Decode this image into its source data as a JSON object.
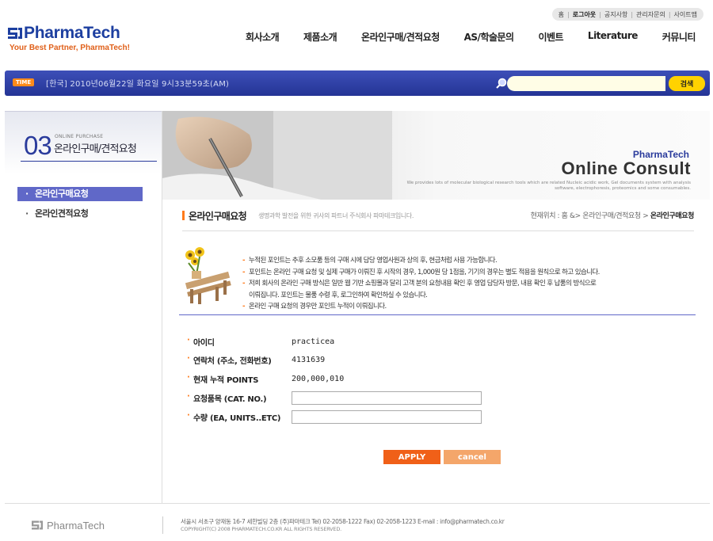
{
  "util_nav": [
    "홈",
    "로그아웃",
    "공지사항",
    "관리자문의",
    "사이트맵"
  ],
  "logo": {
    "name": "PharmaTech",
    "tagline": "Your Best Partner, PharmaTech!"
  },
  "gnb": [
    "회사소개",
    "제품소개",
    "온라인구매/견적요청",
    "AS/학술문의",
    "이벤트",
    "Literature",
    "커뮤니티"
  ],
  "timebar": {
    "badge": "TIME",
    "clock": "[한국]  2010년06월22일 화요일   9시33분59초(AM)",
    "search_button": "검색",
    "search_value": ""
  },
  "section": {
    "number": "03",
    "en": "ONLINE PURCHASE",
    "title": "온라인구매/견적요청",
    "submenu": [
      "온라인구매요청",
      "온라인견적요청"
    ]
  },
  "banner": {
    "brand": "PharmaTech",
    "title": "Online Consult",
    "desc": "We provides lots of molecular biological research tools which are related Nucleic acidic work, Gel documents system with analysis software, electrophoresis, proteomics and some consumables."
  },
  "page": {
    "title": "온라인구매요청",
    "subtitle": "생명과학 발전을 위한 귀사의 파트너 주식회사 파마테크입니다.",
    "crumb_prefix": "현재위치 : 홈 &> 온라인구매/견적요청 > ",
    "crumb_current": "온라인구매요청"
  },
  "notice": [
    "누적된 포인트는 추후 소모품 등의 구매 시에 담당 영업사원과 상의 후, 현금처럼 사용 가능합니다.",
    "포인트는 온라인 구매 요청 및 실제 구매가 이뤄진 후 시작의 경우, 1,000원 당 1점을,  기기의 경우는 별도 적용을 원칙으로 하고 있습니다.",
    "저희 회사의 온라인 구매 방식은 일반 웹 기반 쇼핑몰과 달리 고객 분의 요청내용 확인 후 영업 담당자 방문, 내용 확인 후 납품의 방식으로",
    "이뤄집니다. 포인트는 물품 수령 후, 로그인하여 확인하실 수 있습니다.",
    "온라인 구매 요청의 경우만 포인트 누적이 이뤄집니다."
  ],
  "form": {
    "id_label": "아이디",
    "id_value": "practicea",
    "contact_label": "연락처 (주소, 전화번호)",
    "contact_value": "4131639",
    "points_label": "현재 누적 POINTS",
    "points_value": "200,000,010",
    "item_label": "요청품목 (CAT. NO.)",
    "item_value": "",
    "qty_label": "수량 (EA, UNITS..ETC)",
    "qty_value": ""
  },
  "buttons": {
    "apply": "APPLY",
    "cancel": "cancel"
  },
  "footer": {
    "logo": "PharmaTech",
    "address": "서울시 서초구 양재동 16-7 세한빌딩 2층 (주)파마테크  Tel) 02-2058-1222  Fax) 02-2058-1223   E-mail : info@pharmatech.co.kr",
    "copyright": "COPYRIGHT(C) 2008 PHARMATECH.CO.KR ALL RIGHTS RESERVED."
  },
  "colors": {
    "brand_blue": "#1d3fa0",
    "accent_orange": "#f06018",
    "menu_active": "#6068c8"
  }
}
